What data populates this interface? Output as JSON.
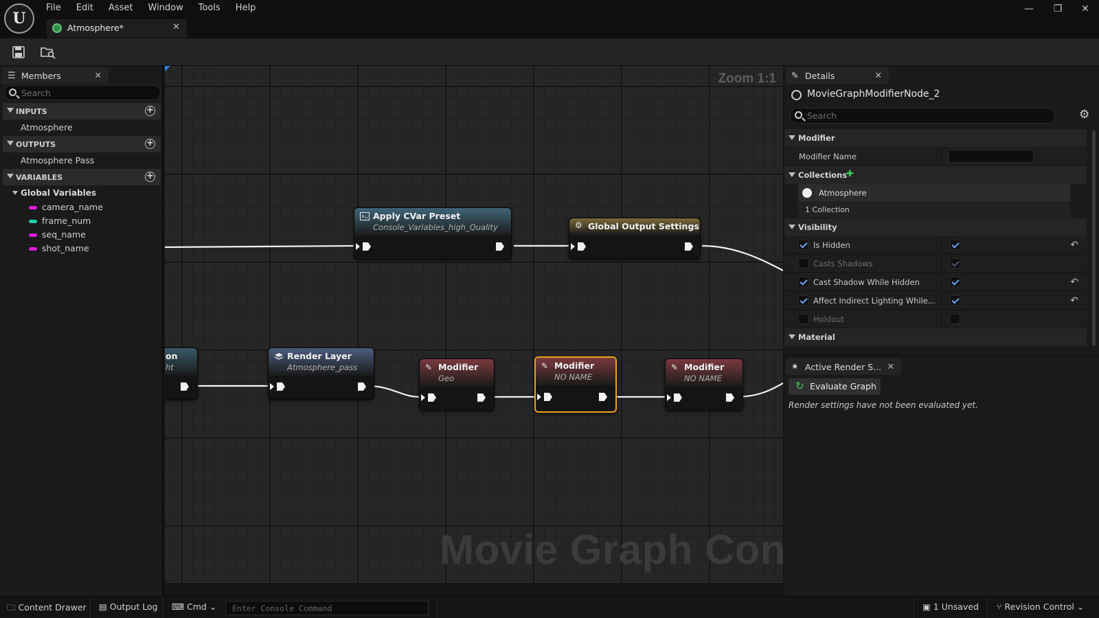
{
  "app": {
    "menu": [
      "File",
      "Edit",
      "Asset",
      "Window",
      "Tools",
      "Help"
    ],
    "logo_text": "U",
    "document_tab": "Atmosphere*",
    "window_controls": [
      "—",
      "❐",
      "✕"
    ]
  },
  "members": {
    "tab_label": "Members",
    "search_placeholder": "Search",
    "inputs_header": "INPUTS",
    "inputs": [
      "Atmosphere"
    ],
    "outputs_header": "OUTPUTS",
    "outputs": [
      "Atmosphere Pass"
    ],
    "variables_header": "VARIABLES",
    "global_variables_label": "Global Variables",
    "variables": [
      {
        "name": "camera_name",
        "color": "#e21be0"
      },
      {
        "name": "frame_num",
        "color": "#1fd3a8"
      },
      {
        "name": "seq_name",
        "color": "#e21be0"
      },
      {
        "name": "shot_name",
        "color": "#e21be0"
      }
    ]
  },
  "graph": {
    "zoom_label": "Zoom 1:1",
    "watermark": "Movie Graph Config",
    "nodes": {
      "cvar": {
        "title": "Apply CVar Preset",
        "subtitle": "Console_Variables_high_Quality",
        "color": "#3f6478"
      },
      "global_output": {
        "title": "Global Output Settings",
        "color": "#7a6a3a"
      },
      "partial": {
        "title": "on",
        "subtitle": "ht",
        "color": "#3a5a6a"
      },
      "render_layer": {
        "title": "Render Layer",
        "subtitle": "Atmosphere_pass",
        "color": "#4c5d80"
      },
      "modifier_geo": {
        "title": "Modifier",
        "subtitle": "Geo",
        "color": "#7a3a3e"
      },
      "modifier_sel": {
        "title": "Modifier",
        "subtitle": "NO NAME",
        "color": "#7a3a3e"
      },
      "modifier_3": {
        "title": "Modifier",
        "subtitle": "NO NAME",
        "color": "#7a3a3e"
      }
    }
  },
  "details": {
    "tab_label": "Details",
    "object_name": "MovieGraphModifierNode_2",
    "search_placeholder": "Search",
    "sections": {
      "modifier": "Modifier",
      "collections": "Collections",
      "visibility": "Visibility",
      "material": "Material"
    },
    "modifier_name_label": "Modifier Name",
    "modifier_name_value": "",
    "collection_item": "Atmosphere",
    "collection_count": "1 Collection",
    "visibility_props": [
      {
        "label": "Is Hidden",
        "override": true,
        "value": true,
        "enabled": true,
        "reset": true
      },
      {
        "label": "Casts Shadows",
        "override": false,
        "value": true,
        "enabled": false,
        "reset": false
      },
      {
        "label": "Cast Shadow While Hidden",
        "override": true,
        "value": true,
        "enabled": true,
        "reset": true
      },
      {
        "label": "Affect Indirect Lighting While...",
        "override": true,
        "value": true,
        "enabled": true,
        "reset": true
      },
      {
        "label": "Holdout",
        "override": false,
        "value": false,
        "enabled": false,
        "reset": false
      }
    ]
  },
  "render_settings": {
    "tab_label": "Active Render S...",
    "evaluate_button": "Evaluate Graph",
    "status_message": "Render settings have not been evaluated yet."
  },
  "statusbar": {
    "content_drawer": "Content Drawer",
    "output_log": "Output Log",
    "cmd": "Cmd",
    "console_placeholder": "Enter Console Command",
    "unsaved": "1 Unsaved",
    "revision_control": "Revision Control"
  }
}
